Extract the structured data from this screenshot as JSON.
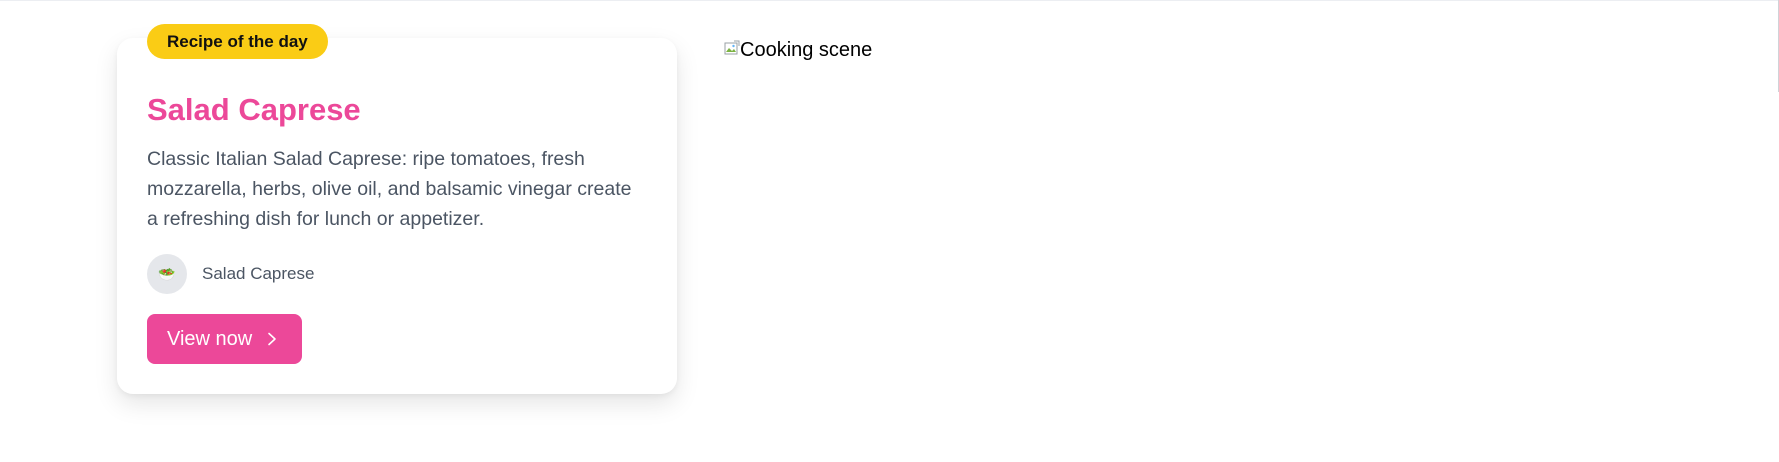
{
  "card": {
    "badge": "Recipe of the day",
    "title": "Salad Caprese",
    "description": "Classic Italian Salad Caprese: ripe tomatoes, fresh mozzarella, herbs, olive oil, and balsamic vinegar create a refreshing dish for lunch or appetizer.",
    "author": {
      "name": "Salad Caprese",
      "avatar_icon": "salad-icon"
    },
    "button": {
      "label": "View now",
      "icon": "chevron-right-icon"
    }
  },
  "image": {
    "alt": "Cooking scene",
    "icon": "broken-image-icon"
  },
  "colors": {
    "accent": "#ec4899",
    "badge": "#facc15",
    "text_muted": "#4b5563"
  }
}
